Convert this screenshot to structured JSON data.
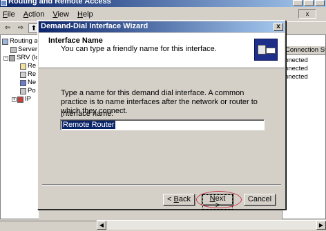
{
  "main_window": {
    "title": "Routing and Remote Access",
    "menu": [
      {
        "label": "File",
        "accel": "F",
        "rest": "ile"
      },
      {
        "label": "Action",
        "accel": "A",
        "rest": "ction"
      },
      {
        "label": "View",
        "accel": "V",
        "rest": "iew"
      },
      {
        "label": "Help",
        "accel": "H",
        "rest": "elp"
      }
    ],
    "menu_right_glyph": "x"
  },
  "toolbar": {
    "back_glyph": "⇦",
    "forward_glyph": "⇨",
    "up_glyph": "⬆"
  },
  "tree": {
    "items": [
      {
        "label": "Routing an",
        "icon": "computer-icon"
      },
      {
        "label": "Server",
        "icon": "server-status-icon"
      },
      {
        "label": "SRV (lc",
        "icon": "server-icon",
        "toggle": "-"
      },
      {
        "label": "Re",
        "icon": "folder-icon"
      },
      {
        "label": "Re",
        "icon": "folder-icon"
      },
      {
        "label": "Ne",
        "icon": "network-icon"
      },
      {
        "label": "Po",
        "icon": "policy-icon"
      },
      {
        "label": "IP",
        "icon": "routing-icon",
        "toggle": "+"
      }
    ]
  },
  "right_pane": {
    "column_header": "Connection State",
    "rows": [
      "nnected",
      "nnected",
      "nnected"
    ]
  },
  "wizard": {
    "title": "Demand-Dial Interface Wizard",
    "close_glyph": "x",
    "heading": "Interface Name",
    "subheading": "You can type a friendly name for this interface.",
    "description": "Type a name for this demand dial interface.  A common practice is to name interfaces after the network or router to which they connect.",
    "field_label": {
      "accel": "I",
      "rest": "nterface name:"
    },
    "field_value": "Remote Router",
    "buttons": {
      "back": {
        "prefix": "< ",
        "accel": "B",
        "rest": "ack"
      },
      "next": {
        "accel": "N",
        "rest": "ext >"
      },
      "cancel": "Cancel"
    }
  },
  "colors": {
    "titlebar_active": "#0a246a",
    "face": "#d4d0c8",
    "highlight_ellipse": "#c83c50"
  }
}
